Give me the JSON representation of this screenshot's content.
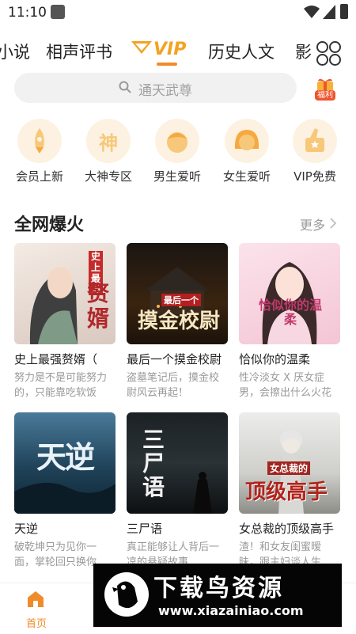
{
  "status_bar": {
    "time": "11:10"
  },
  "tabs": [
    {
      "label": "小说"
    },
    {
      "label": "相声评书"
    },
    {
      "label": "VIP"
    },
    {
      "label": "历史人文"
    },
    {
      "label": "影"
    }
  ],
  "search": {
    "placeholder": "通天武尊"
  },
  "gift_badge": "福利",
  "categories": [
    {
      "label": "会员上新",
      "icon": "rocket-icon"
    },
    {
      "label": "大神专区",
      "icon": "shen-icon",
      "glyph": "神"
    },
    {
      "label": "男生爱听",
      "icon": "boy-face-icon"
    },
    {
      "label": "女生爱听",
      "icon": "girl-face-icon"
    },
    {
      "label": "VIP免费",
      "icon": "thumbs-up-star-icon"
    }
  ],
  "section": {
    "title": "全网爆火",
    "more": "更多"
  },
  "books": [
    {
      "title": "史上最强赘婿（",
      "desc": "努力是不是可能努力的，只能靠吃软饭",
      "cover_text": "赘婿",
      "cover_sub": "史上最强"
    },
    {
      "title": "最后一个摸金校尉",
      "desc": "盗墓笔记后，摸金校尉风云再起！",
      "cover_text": "摸金校尉",
      "cover_sub": "最后一个"
    },
    {
      "title": "恰似你的温柔",
      "desc": "性冷淡女 X 厌女症男，会擦出什么火花",
      "cover_text": "恰似你的温柔"
    },
    {
      "title": "天逆",
      "desc": "破乾坤只为见你一面，掌轮回只换你",
      "cover_text": "天逆"
    },
    {
      "title": "三尸语",
      "desc": "真正能够让人背后一凉的悬疑故事",
      "cover_text": "三尸语"
    },
    {
      "title": "女总裁的顶级高手",
      "desc": "渣！和女友闺蜜暧昧，跟主妇谈人生",
      "cover_text": "顶级高手",
      "cover_sub": "女总裁的"
    }
  ],
  "bottom_nav": {
    "home": "首页"
  },
  "watermark": {
    "name": "下载鸟资源",
    "url": "www.xiazainiao.com"
  },
  "colors": {
    "accent": "#f08b2a",
    "vip": "#f3a321",
    "muted": "#999999"
  }
}
